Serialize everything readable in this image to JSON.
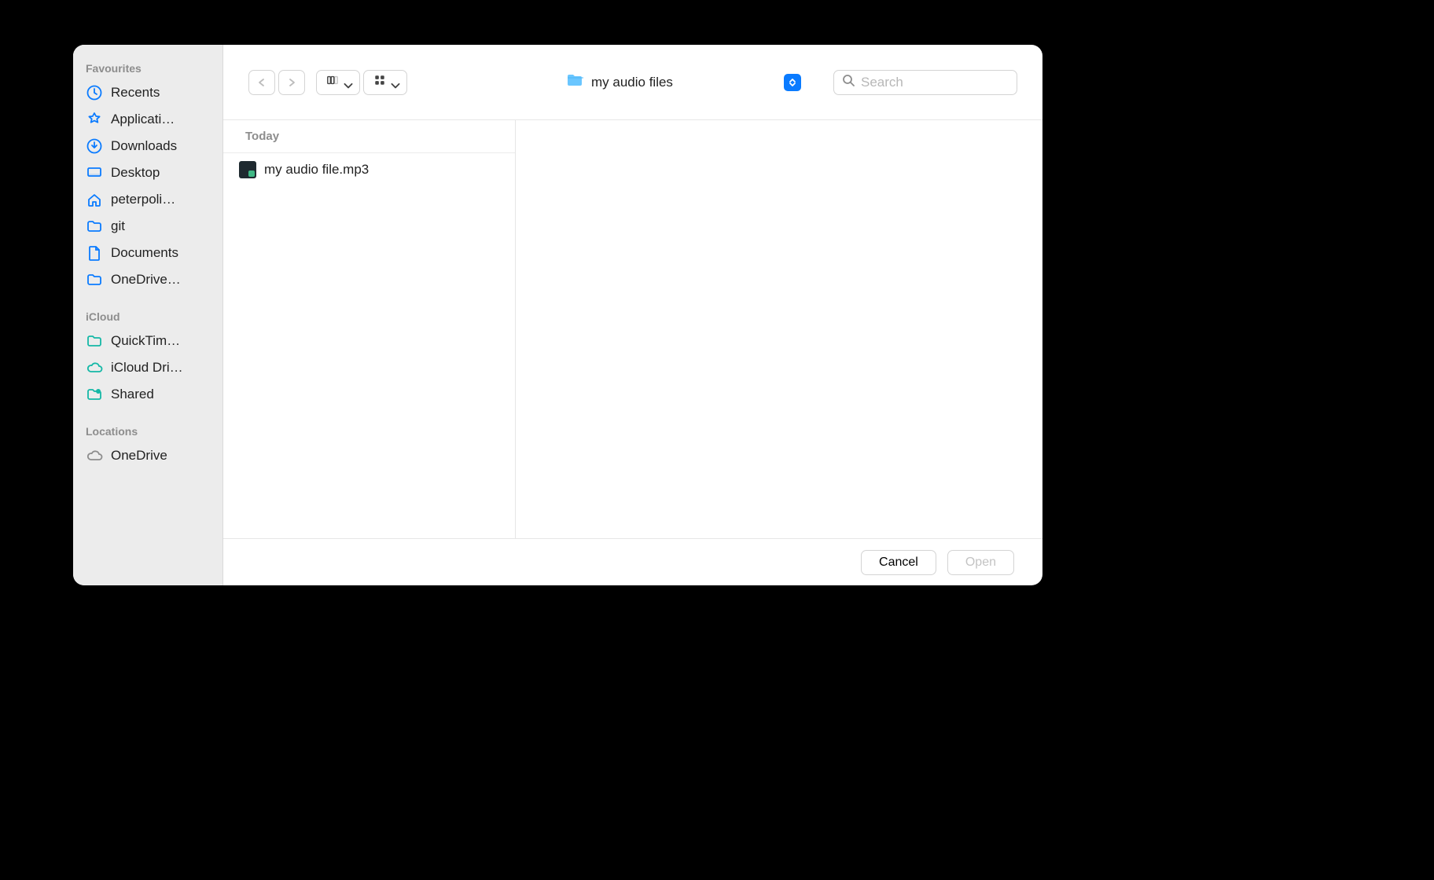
{
  "sidebar": {
    "sections": [
      {
        "title": "Favourites",
        "items": [
          {
            "icon": "clock",
            "label": "Recents"
          },
          {
            "icon": "appstore",
            "label": "Applicati…"
          },
          {
            "icon": "download",
            "label": "Downloads"
          },
          {
            "icon": "desktop",
            "label": "Desktop"
          },
          {
            "icon": "home",
            "label": "peterpoli…"
          },
          {
            "icon": "folder",
            "label": "git"
          },
          {
            "icon": "document",
            "label": "Documents"
          },
          {
            "icon": "folder",
            "label": "OneDrive…"
          }
        ]
      },
      {
        "title": "iCloud",
        "items": [
          {
            "icon": "folder-teal",
            "label": "QuickTim…"
          },
          {
            "icon": "cloud-teal",
            "label": "iCloud Dri…"
          },
          {
            "icon": "shared-teal",
            "label": "Shared"
          }
        ]
      },
      {
        "title": "Locations",
        "items": [
          {
            "icon": "cloud-gray",
            "label": "OneDrive"
          }
        ]
      }
    ]
  },
  "toolbar": {
    "path_folder": "my audio files",
    "search_placeholder": "Search"
  },
  "filelist": {
    "group_label": "Today",
    "items": [
      {
        "name": "my audio file.mp3"
      }
    ]
  },
  "footer": {
    "cancel": "Cancel",
    "open": "Open"
  }
}
